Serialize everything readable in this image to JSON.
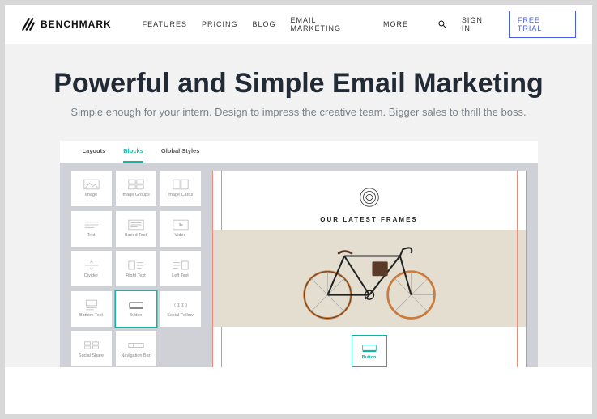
{
  "brand": {
    "name": "BENCHMARK"
  },
  "nav": {
    "items": [
      {
        "label": "FEATURES"
      },
      {
        "label": "PRICING"
      },
      {
        "label": "BLOG"
      },
      {
        "label": "EMAIL MARKETING"
      },
      {
        "label": "MORE"
      }
    ],
    "sign_in": "SIGN IN",
    "free_trial": "FREE TRIAL"
  },
  "hero": {
    "title": "Powerful and Simple Email Marketing",
    "subtitle": "Simple enough for your intern. Design to impress the creative team. Bigger sales to thrill the boss."
  },
  "editor": {
    "tabs": [
      {
        "label": "Layouts"
      },
      {
        "label": "Blocks",
        "active": true
      },
      {
        "label": "Global Styles"
      }
    ],
    "blocks": [
      {
        "label": "Image"
      },
      {
        "label": "Image Groups"
      },
      {
        "label": "Image Cards"
      },
      {
        "label": "Text"
      },
      {
        "label": "Boxed Text"
      },
      {
        "label": "Video"
      },
      {
        "label": "Divider"
      },
      {
        "label": "Right Text"
      },
      {
        "label": "Left Text"
      },
      {
        "label": "Bottom Text"
      },
      {
        "label": "Button"
      },
      {
        "label": "Social Follow"
      },
      {
        "label": "Social Share"
      },
      {
        "label": "Navigation Bar"
      }
    ],
    "canvas": {
      "heading": "OUR LATEST FRAMES",
      "dropped_block": "Button"
    }
  }
}
